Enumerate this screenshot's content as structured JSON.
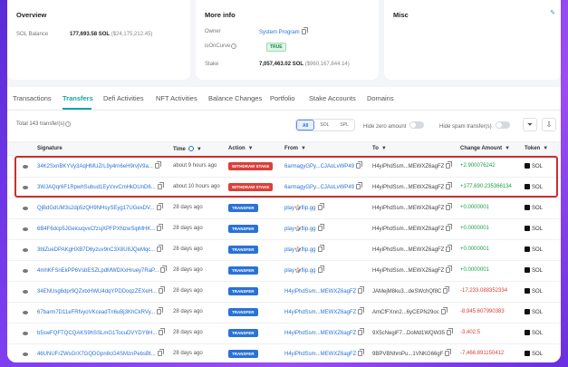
{
  "overview": {
    "title": "Overview",
    "balance_label": "SOL Balance",
    "balance_value": "177,693.58 SOL",
    "balance_usd": "($24,175,212.45)"
  },
  "more_info": {
    "title": "More info",
    "owner_label": "Owner",
    "owner_value": "System Program",
    "oncurve_label": "isOnCurve",
    "oncurve_value": "TRUE",
    "stake_label": "Stake",
    "stake_value": "7,057,463.02 SOL",
    "stake_usd": "($960,167,844.14)"
  },
  "misc": {
    "title": "Misc"
  },
  "tabs": [
    "Transactions",
    "Transfers",
    "Defi Activities",
    "NFT Activities",
    "Balance Changes",
    "Portfolio",
    "Stake Accounts",
    "Domains"
  ],
  "toolbar": {
    "total": "Total 143 transfer(s)",
    "seg_all": "All",
    "seg_sol": "SOL",
    "seg_spl": "SPL",
    "hide_zero": "Hide zero amount",
    "hide_spam": "Hide spam transfer(s)"
  },
  "columns": {
    "signature": "Signature",
    "time": "Time",
    "action": "Action",
    "from": "From",
    "to": "To",
    "change": "Change Amount",
    "token": "Token"
  },
  "rows": [
    {
      "sig": "34K2SxnBKYVy3AqHMUZrL9y4rn6eH9rvjV9a...",
      "time": "about 9 hours ago",
      "action": "WITHDRAW STAKE",
      "from": "6armagyGPy...CJAoLvWP49",
      "to": "H4yiPhdSsm...MEWXZ6agFZ",
      "change": "+2.900076242",
      "token": "SOL"
    },
    {
      "sig": "3WJAQqr6F1RpwhSubud1EyVxvCmHkDUnD6...",
      "time": "about 10 hours ago",
      "action": "WITHDRAW STAKE",
      "from": "6armagyGPy...CJAoLvWP49",
      "to": "H4yiPhdSsm...MEWXZ6agFZ",
      "change": "+177,690.235366134",
      "token": "SOL"
    },
    {
      "sig": "QjBdGdUM3s2dp5zQH9NHsySEyg17UGexDV...",
      "time": "28 days ago",
      "action": "TRANSFER",
      "from": "play🎲flip.gg",
      "to": "H4yiPhdSsm...MEWXZ6agFZ",
      "change": "+0.0000001",
      "token": "SOL"
    },
    {
      "sig": "6B4F6dcp5JGeicuqvxCfzsjXPFPXNzwSipMHK...",
      "time": "28 days ago",
      "action": "TRANSFER",
      "from": "play🎲flip.gg",
      "to": "H4yiPhdSsm...MEWXZ6agFZ",
      "change": "+0.0000001",
      "token": "SOL"
    },
    {
      "sig": "3btZueDPAKgHXB7D6yzuv9nC3X8U8JQeMqc...",
      "time": "28 days ago",
      "action": "TRANSFER",
      "from": "play🎲flip.gg",
      "to": "H4yiPhdSsm...MEWXZ6agFZ",
      "change": "+0.0000001",
      "token": "SOL"
    },
    {
      "sig": "4mhKFSnEkPP6VsbESZLpdMWDXxHruey7RaP...",
      "time": "28 days ago",
      "action": "TRANSFER",
      "from": "play🎲flip.gg",
      "to": "H4yiPhdSsm...MEWXZ6agFZ",
      "change": "+0.0000001",
      "token": "SOL"
    },
    {
      "sig": "34ENUsg6dpr9QZxtxHWU4dqYPDDoqzZEXeH...",
      "time": "28 days ago",
      "action": "TRANSFER",
      "from": "H4yiPhdSsm...MEWXZ6agFZ",
      "to": "JAMejM8ku3...deSWchQf8C",
      "change": "-17,233.088352334",
      "token": "SOL"
    },
    {
      "sig": "67barm7D11eFRfvyoVKceadTn6uBj3KhCkRVy...",
      "time": "28 days ago",
      "action": "TRANSFER",
      "from": "H4yiPhdSsm...MEWXZ6agFZ",
      "to": "AmCfFXnn2...6yCEPN29oc",
      "change": "-8,945.607990383",
      "token": "SOL"
    },
    {
      "sig": "b5swFQFTQCQAKS9hSSLmG1TocuDVYDY6H...",
      "time": "28 days ago",
      "action": "TRANSFER",
      "from": "H4yiPhdSsm...MEWXZ6agFZ",
      "to": "9X5cNegiF7...DoMd1WQW35",
      "change": "-3,402.5",
      "token": "SOL"
    },
    {
      "sig": "46UNUFrZWsGrX7GQDGpn8cG4SMznPebsBt...",
      "time": "28 days ago",
      "action": "TRANSFER",
      "from": "H4yiPhdSsm...MEWXZ6agFZ",
      "to": "9BPVBNhmPu...1VNKG66gF",
      "change": "-7,466.891150412",
      "token": "SOL"
    }
  ]
}
